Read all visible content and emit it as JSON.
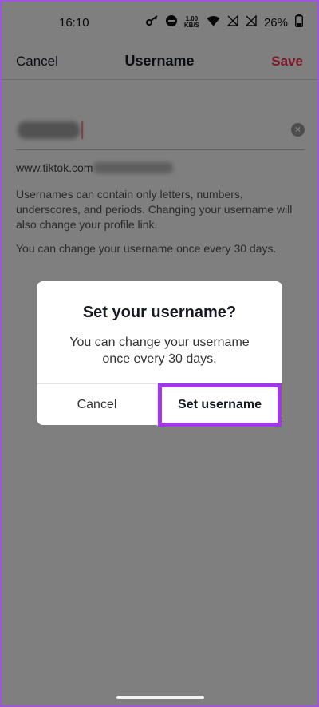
{
  "status_bar": {
    "time": "16:10",
    "net_speed_value": "1.00",
    "net_speed_unit": "KB/S",
    "battery": "26%"
  },
  "header": {
    "cancel_label": "Cancel",
    "title": "Username",
    "save_label": "Save"
  },
  "form": {
    "link_prefix": "www.tiktok.com",
    "help_text": "Usernames can contain only letters, numbers, underscores, and periods. Changing your username will also change your profile link.",
    "limit_text": "You can change your username once every 30 days."
  },
  "dialog": {
    "title": "Set your username?",
    "message": "You can change your username once every 30 days.",
    "cancel_label": "Cancel",
    "confirm_label": "Set username"
  },
  "colors": {
    "accent": "#fe2c55",
    "highlight_border": "#a038e8"
  }
}
